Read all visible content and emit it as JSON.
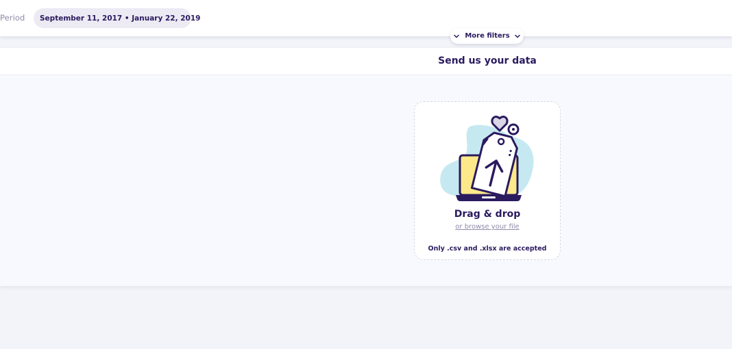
{
  "filters": {
    "period_label": "Period",
    "period_value": "September 11, 2017 • January 22, 2019",
    "more_filters_label": "More filters"
  },
  "card": {
    "title": "Send us your data"
  },
  "dropzone": {
    "title": "Drag & drop",
    "browse_link": "or browse your file",
    "note": "Only .csv and .xlsx are accepted"
  },
  "icons": {
    "period_chevron": "chevron-down-icon",
    "more_filters_left": "chevron-down-icon",
    "more_filters_right": "chevron-down-icon",
    "upload_illustration": "laptop-upload-illustration"
  },
  "colors": {
    "primary_text": "#2a1a5e",
    "muted_text": "#8e8aa8",
    "illustration_yellow": "#fde98a",
    "illustration_blue": "#c6e9f1"
  }
}
